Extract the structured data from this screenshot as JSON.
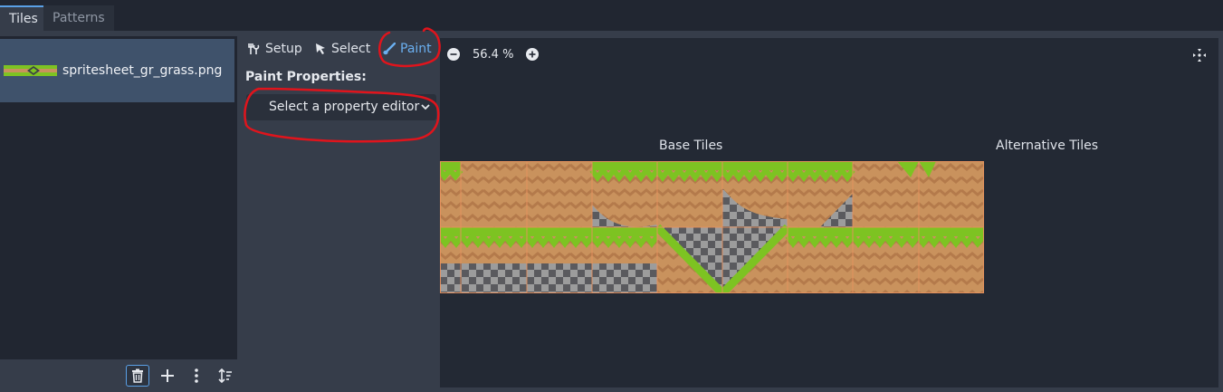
{
  "tabs": [
    {
      "label": "Tiles",
      "active": true
    },
    {
      "label": "Patterns",
      "active": false
    }
  ],
  "sources": [
    {
      "label": "spritesheet_gr_grass.png",
      "selected": true
    }
  ],
  "bottom_tools": [
    {
      "name": "delete-source",
      "icon": "trash-icon"
    },
    {
      "name": "add-source",
      "icon": "plus-icon"
    },
    {
      "name": "more-options",
      "icon": "kebab-menu-icon"
    },
    {
      "name": "sort-sources",
      "icon": "sort-icon"
    }
  ],
  "modes": {
    "setup_label": "Setup",
    "select_label": "Select",
    "paint_label": "Paint",
    "active": "Paint"
  },
  "paint_properties": {
    "heading": "Paint Properties:",
    "select_value": "Select a property editor"
  },
  "zoom": {
    "value": "56.4 %"
  },
  "atlas": {
    "base_label": "Base Tiles",
    "alt_label": "Alternative Tiles"
  },
  "colors": {
    "accent": "#6aaff0",
    "grass": "#7dc322",
    "dirt": "#c9925d",
    "annotation": "#e0141c"
  }
}
